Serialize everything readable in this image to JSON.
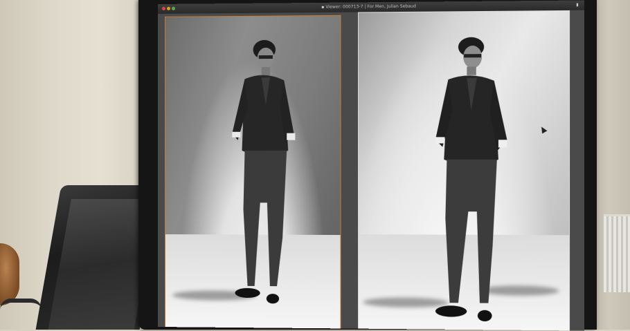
{
  "window": {
    "title": "Viewer: 000713-7 | For Men, Julian Sebaud",
    "right_indicator": "▮"
  },
  "photos": [
    {
      "name": "photo-left",
      "selected": true
    },
    {
      "name": "photo-right",
      "selected": false
    }
  ],
  "colors": {
    "selection_border": "#c8792e",
    "bezel": "#151515",
    "viewer_bg": "#4a4a4a"
  },
  "icons": [
    "close-icon",
    "minimize-icon",
    "maximize-icon",
    "cursor-icon"
  ]
}
